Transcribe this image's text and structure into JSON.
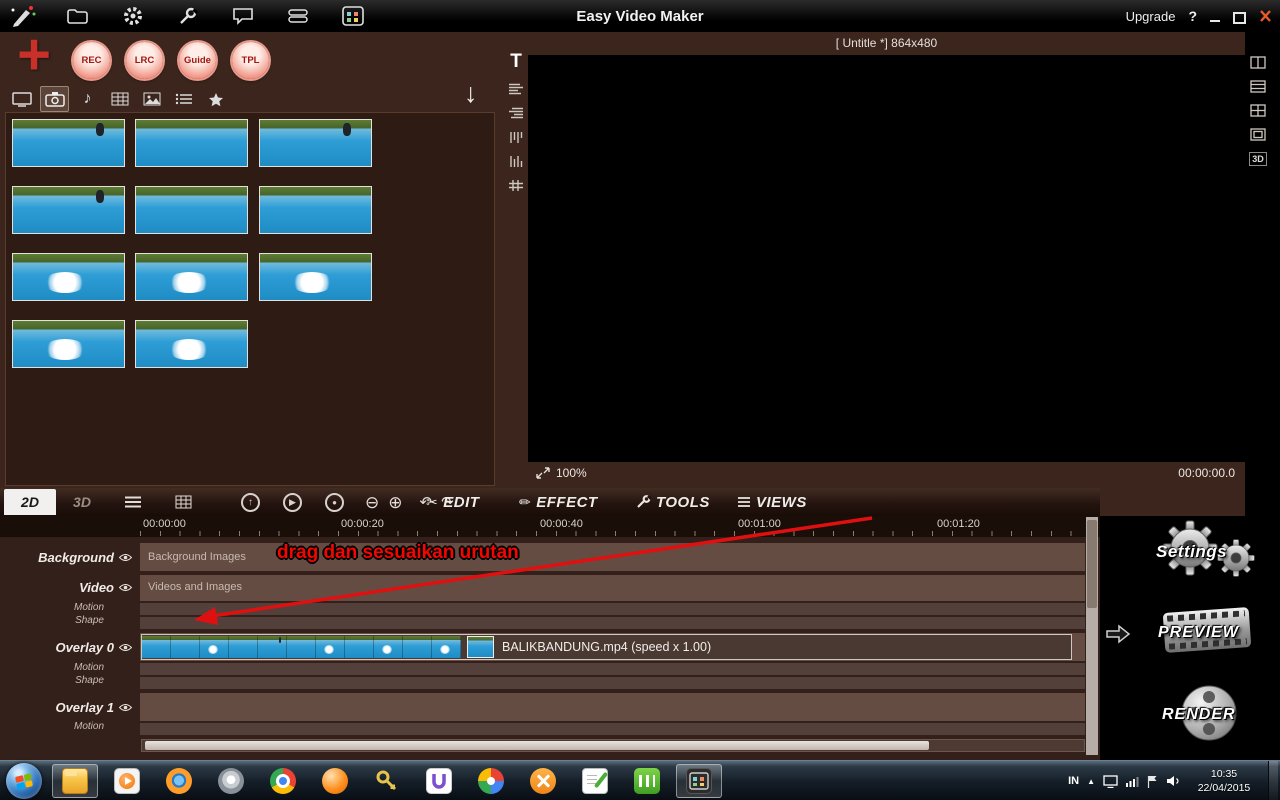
{
  "titlebar": {
    "title": "Easy Video Maker",
    "upgrade": "Upgrade",
    "help": "?"
  },
  "launcher": {
    "rec": "REC",
    "lrc": "LRC",
    "guide": "Guide",
    "tpl": "TPL"
  },
  "preview": {
    "doc_label": "[ Untitle *]  864x480",
    "zoom_level": "100%",
    "timecode": "00:00:00.0",
    "text_tool": "T",
    "side_3d": "3D"
  },
  "toolbar": {
    "tab_2d": "2D",
    "tab_3d": "3D",
    "menu_edit": "EDIT",
    "menu_effect": "EFFECT",
    "menu_tools": "TOOLS",
    "menu_views": "VIEWS"
  },
  "timeline": {
    "ruler": [
      "00:00:00",
      "00:00:20",
      "00:00:40",
      "00:01:00",
      "00:01:20"
    ],
    "annotation": "drag dan sesuaikan urutan",
    "tracks": {
      "background": {
        "name": "Background",
        "row_label": "Background Images"
      },
      "video": {
        "name": "Video",
        "row_label": "Videos and Images",
        "motion": "Motion",
        "shape": "Shape"
      },
      "overlay0": {
        "name": "Overlay 0",
        "motion": "Motion",
        "shape": "Shape",
        "clip_label": "BALIKBANDUNG.mp4  (speed x 1.00)"
      },
      "overlay1": {
        "name": "Overlay 1",
        "motion": "Motion"
      }
    }
  },
  "side_actions": {
    "settings": "Settings",
    "preview": "PREVIEW",
    "render": "RENDER"
  },
  "taskbar": {
    "language": "IN",
    "time": "10:35",
    "date": "22/04/2015"
  },
  "icons": {
    "plus": "+",
    "down_arrow": "↓",
    "music_note": "♪",
    "up": "↑",
    "play": "▶",
    "record": "●",
    "zoom_out": "⊖",
    "zoom_in": "⊕",
    "undo": "↶",
    "redo": "↷",
    "scissors": "✂",
    "pencil": "✏",
    "caret": "▲"
  }
}
